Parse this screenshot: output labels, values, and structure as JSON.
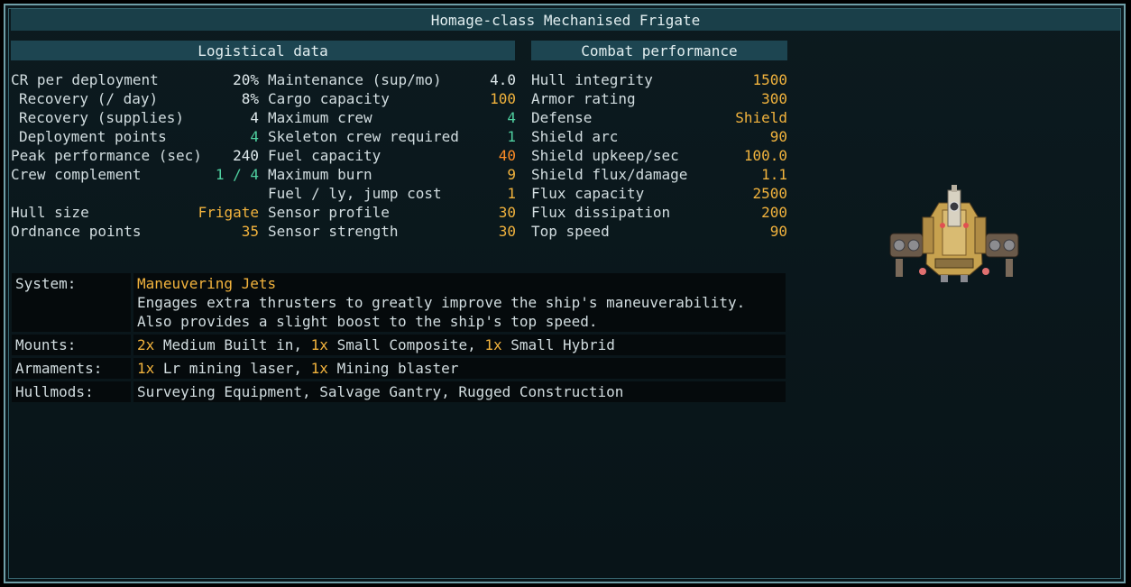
{
  "title": "Homage-class Mechanised Frigate",
  "headers": {
    "logistical": "Logistical data",
    "combat": "Combat performance"
  },
  "col1": [
    {
      "label": "CR per deployment",
      "value": "20%",
      "color": "white",
      "indent": false
    },
    {
      "label": "Recovery (/ day)",
      "value": "8%",
      "color": "white",
      "indent": true
    },
    {
      "label": "Recovery (supplies)",
      "value": "4",
      "color": "white",
      "indent": true
    },
    {
      "label": "Deployment points",
      "value": "4",
      "color": "green",
      "indent": true
    },
    {
      "label": "Peak performance (sec)",
      "value": "240",
      "color": "white",
      "indent": false
    },
    {
      "label": "Crew complement",
      "value": "1 / 4",
      "color": "green",
      "indent": false
    },
    {
      "label": "",
      "value": "",
      "color": "white",
      "indent": false
    },
    {
      "label": "Hull size",
      "value": "Frigate",
      "color": "gold",
      "indent": false
    },
    {
      "label": "Ordnance points",
      "value": "35",
      "color": "gold",
      "indent": false
    }
  ],
  "col2": [
    {
      "label": "Maintenance (sup/mo)",
      "value": "4.0",
      "color": "white"
    },
    {
      "label": "Cargo capacity",
      "value": "100",
      "color": "gold"
    },
    {
      "label": "Maximum crew",
      "value": "4",
      "color": "green"
    },
    {
      "label": "Skeleton crew required",
      "value": "1",
      "color": "green"
    },
    {
      "label": "Fuel capacity",
      "value": "40",
      "color": "orange"
    },
    {
      "label": "Maximum burn",
      "value": "9",
      "color": "gold"
    },
    {
      "label": "Fuel / ly, jump cost",
      "value": "1",
      "color": "gold"
    },
    {
      "label": "Sensor profile",
      "value": "30",
      "color": "gold"
    },
    {
      "label": "Sensor strength",
      "value": "30",
      "color": "gold"
    }
  ],
  "col3": [
    {
      "label": "Hull integrity",
      "value": "1500",
      "color": "gold"
    },
    {
      "label": "Armor rating",
      "value": "300",
      "color": "gold"
    },
    {
      "label": "Defense",
      "value": "Shield",
      "color": "gold"
    },
    {
      "label": "Shield arc",
      "value": "90",
      "color": "gold"
    },
    {
      "label": "Shield upkeep/sec",
      "value": "100.0",
      "color": "gold"
    },
    {
      "label": "Shield flux/damage",
      "value": "1.1",
      "color": "gold"
    },
    {
      "label": "Flux capacity",
      "value": "2500",
      "color": "gold"
    },
    {
      "label": "Flux dissipation",
      "value": "200",
      "color": "gold"
    },
    {
      "label": "Top speed",
      "value": "90",
      "color": "gold"
    }
  ],
  "details": {
    "system_key": "System:",
    "system_name": "Maneuvering Jets",
    "system_desc": "Engages extra thrusters to greatly improve the ship's maneuverability. Also provides a slight boost to the ship's top speed.",
    "mounts_key": "Mounts:",
    "mounts": [
      {
        "count": "2x",
        "name": "Medium Built in"
      },
      {
        "count": "1x",
        "name": "Small Composite"
      },
      {
        "count": "1x",
        "name": "Small Hybrid"
      }
    ],
    "armaments_key": "Armaments:",
    "armaments": [
      {
        "count": "1x",
        "name": "Lr mining laser"
      },
      {
        "count": "1x",
        "name": "Mining blaster"
      }
    ],
    "hullmods_key": "Hullmods:",
    "hullmods": "Surveying Equipment, Salvage Gantry, Rugged Construction"
  },
  "icons": {
    "ship": "ship-sprite-icon"
  },
  "colors": {
    "accent": "#f2b33d",
    "green": "#4fd0a0",
    "orange": "#ff8c26",
    "header_bg": "#1d4551"
  }
}
